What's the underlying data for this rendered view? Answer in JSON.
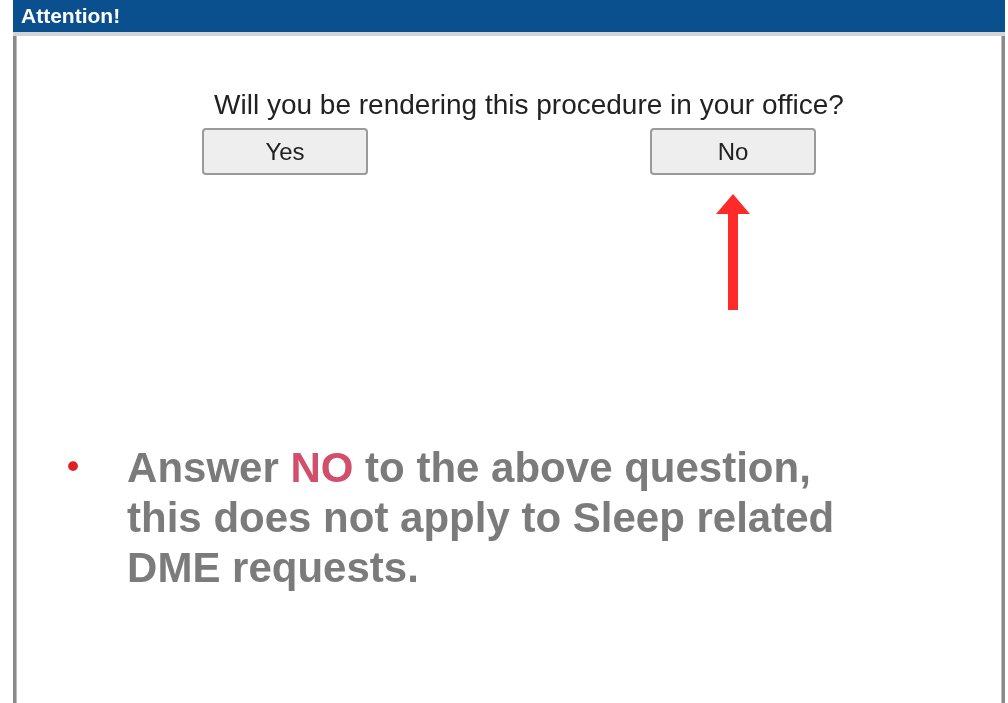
{
  "dialog": {
    "title": "Attention!",
    "question": "Will you be rendering this procedure in your office?",
    "buttons": [
      {
        "label": "Yes"
      },
      {
        "label": "No"
      }
    ]
  },
  "note": {
    "bullet": "•",
    "segments": [
      {
        "text": "Answer ",
        "emphasis": false
      },
      {
        "text": "NO",
        "emphasis": true
      },
      {
        "text": " to the above question, this does not apply to Sleep related DME requests.",
        "emphasis": false
      }
    ]
  }
}
